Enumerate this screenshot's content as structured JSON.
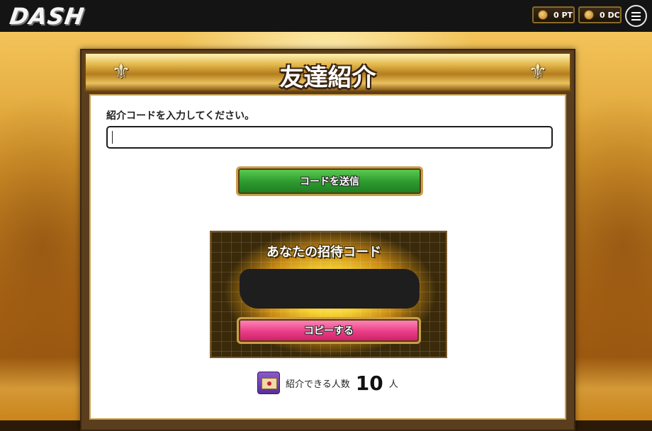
{
  "header": {
    "logo_text": "DASH",
    "points_pt": "0 PT",
    "points_dc": "0 DC",
    "pt_icon": "coin-icon",
    "dc_icon": "coin-icon",
    "menu_icon": "hamburger-menu-icon"
  },
  "panel": {
    "title": "友達紹介",
    "ornament_icon": "fleur-de-lis-icon",
    "code_label": "紹介コードを入力してください。",
    "code_input_value": "",
    "send_button_label": "コードを送信",
    "invite_title": "あなたの招待コード",
    "copy_button_label": "コピーする",
    "count_label": "紹介できる人数",
    "count_value": "10",
    "count_unit": "人",
    "count_icon": "letter-envelope-icon"
  },
  "colors": {
    "topbar_bg": "#141414",
    "send_button": "#2f9d2f",
    "copy_button": "#ea3c86",
    "gold": "#c8a04a"
  }
}
